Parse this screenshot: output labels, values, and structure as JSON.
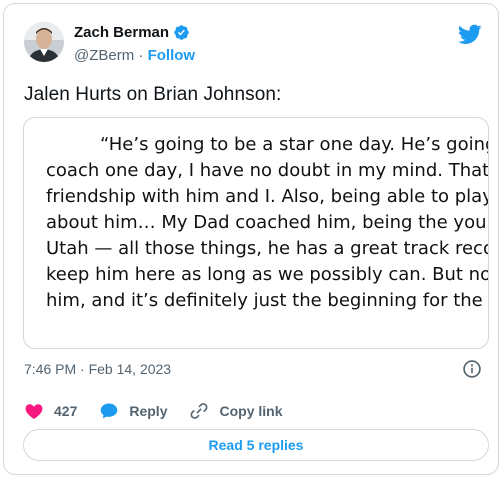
{
  "author": {
    "name": "Zach Berman",
    "handle": "@ZBerm",
    "separator": " · ",
    "follow_label": "Follow"
  },
  "tweet": {
    "text": "Jalen Hurts on Brian Johnson:",
    "quote_lines": [
      "“He’s going to be a star one day. He’s going t",
      "coach one day, I have no doubt in my mind. That’s",
      "friendship with him and I. Also, being able to play",
      "about him… My Dad coached him, being the young",
      "Utah — all those things, he has a great track recor",
      "keep him here as long as we possibly can. But non",
      "him, and it’s definitely just the beginning for the b"
    ],
    "timestamp": "7:46 PM · Feb 14, 2023"
  },
  "actions": {
    "like_count": "427",
    "reply_label": "Reply",
    "copy_link_label": "Copy link"
  },
  "read_replies_label": "Read 5 replies",
  "icons": {
    "verified": "verified-badge-icon",
    "brand": "twitter-bird-icon",
    "info": "info-icon",
    "like": "heart-icon",
    "reply": "speech-bubble-icon",
    "copy": "link-icon"
  },
  "colors": {
    "accent": "#1d9bf0",
    "like": "#f91880",
    "secondary_text": "#536471",
    "border": "#cfd9de"
  }
}
